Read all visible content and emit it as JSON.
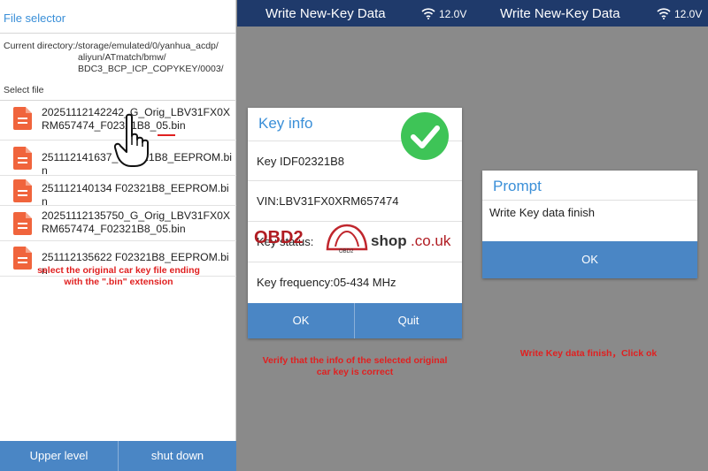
{
  "left_panel": {
    "title": "File selector",
    "current_directory_label": "Current directory:/storage/emulated/0/yanhua_acdp/",
    "current_directory_lines": [
      "aliyun/ATmatch/bmw/",
      "BDC3_BCP_ICP_COPYKEY/0003/"
    ],
    "select_file_label": "Select file",
    "files": [
      {
        "name": "20251112142242_G_Orig_LBV31FX0XRM657474_F02321B8_05.bin"
      },
      {
        "name": "251112141637_F02321B8_EEPROM.bin"
      },
      {
        "name": "251112140134 F02321B8_EEPROM.bin"
      },
      {
        "name": "20251112135750_G_Orig_LBV31FX0XRM657474_F02321B8_05.bin"
      },
      {
        "name": "251112135622 F02321B8_EEPROM.bin"
      }
    ],
    "buttons": {
      "upper_level": "Upper level",
      "shut_down": "shut down"
    },
    "note": "select the original car key file ending with the \".bin\" extension"
  },
  "middle_panel": {
    "header_title": "Write New-Key Data",
    "voltage": "12.0V",
    "dialog": {
      "title": "Key info",
      "key_id": "Key IDF02321B8",
      "vin": "VIN:LBV31FX0XRM657474",
      "key_status": "Key status:",
      "frequency": "Key frequency:05-434 MHz",
      "ok": "OK",
      "quit": "Quit"
    },
    "note": "Verify that the info of the selected original car key is correct"
  },
  "right_panel": {
    "header_title": "Write New-Key Data",
    "voltage": "12.0V",
    "dialog": {
      "title": "Prompt",
      "message": "Write Key data finish",
      "ok": "OK"
    },
    "note": "Write Key data finish，Click ok"
  },
  "watermark": {
    "obd": "OBD2",
    "shop": "shop",
    "couk": ".co.uk",
    "badge": "OBD2"
  },
  "colors": {
    "header_bg": "#1f3a6b",
    "button_bg": "#4a86c5",
    "accent_blue": "#3a8fd8",
    "note_red": "#e02020",
    "file_icon": "#f0643c",
    "check_green": "#3ec457",
    "background_gray": "#8a8a8a"
  },
  "icons": [
    "file-icon",
    "pointing-hand-icon",
    "wifi-icon",
    "checkmark-icon"
  ]
}
